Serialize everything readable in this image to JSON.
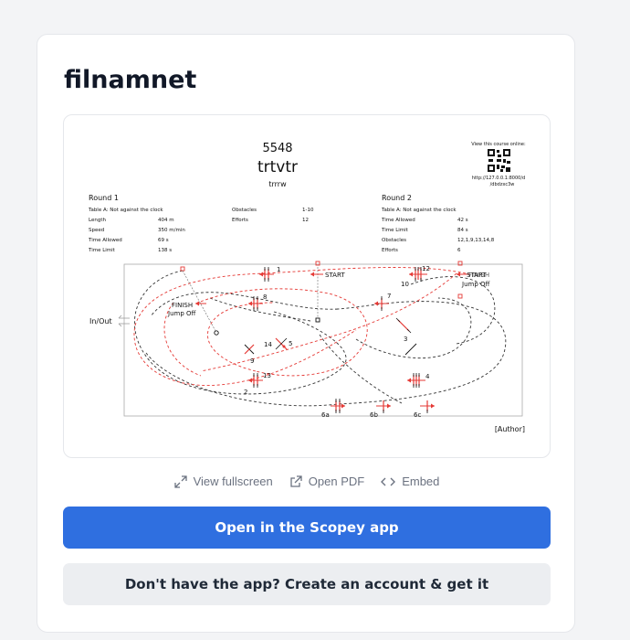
{
  "title": "filnamnet",
  "course": {
    "number": "5548",
    "name": "trtvtr",
    "subtitle": "trrrw",
    "view_online": "View this course online:",
    "url_line1": "http://127.0.0.1:8000/d",
    "url_line2": "/dbdzxc3w",
    "author": "[Author]",
    "in_out": "In/Out",
    "start": "START",
    "finish_jumpoff_left_1": "FINISH",
    "finish_jumpoff_left_2": "Jump Off",
    "finish_right_overlap": "START",
    "finish_right_over": "FINISH",
    "jumpoff_right": "Jump Off",
    "round1": {
      "title": "Round 1",
      "table": "Table A: Not against the clock",
      "rows": [
        {
          "label": "Length",
          "value": "404 m"
        },
        {
          "label": "Speed",
          "value": "350 m/min"
        },
        {
          "label": "Time Allowed",
          "value": "69 s"
        },
        {
          "label": "Time Limit",
          "value": "138 s"
        }
      ],
      "obstacles_label": "Obstacles",
      "obstacles_value": "1-10",
      "efforts_label": "Efforts",
      "efforts_value": "12"
    },
    "round2": {
      "title": "Round 2",
      "table": "Table A: Not against the clock",
      "rows": [
        {
          "label": "Time Allowed",
          "value": "42 s"
        },
        {
          "label": "Time Limit",
          "value": "84 s"
        },
        {
          "label": "Obstacles",
          "value": "12,1,9,13,14,8"
        },
        {
          "label": "Efforts",
          "value": "6"
        }
      ]
    },
    "obstacle_labels": {
      "o1": "1",
      "o2": "2",
      "o3": "3",
      "o4": "4",
      "o5": "5",
      "o6a": "6a",
      "o6b": "6b",
      "o6c": "6c",
      "o7": "7",
      "o8": "8",
      "o9": "9",
      "o10": "10",
      "o12": "12",
      "o13": "13",
      "o14": "14"
    }
  },
  "actions": {
    "fullscreen": "View fullscreen",
    "pdf": "Open PDF",
    "embed": "Embed"
  },
  "buttons": {
    "open_app": "Open in the Scopey app",
    "create_account": "Don't have the app? Create an account & get it"
  },
  "colors": {
    "primary": "#2f6fe0",
    "obstacle_red": "#e53935",
    "path_dark": "#333333"
  }
}
